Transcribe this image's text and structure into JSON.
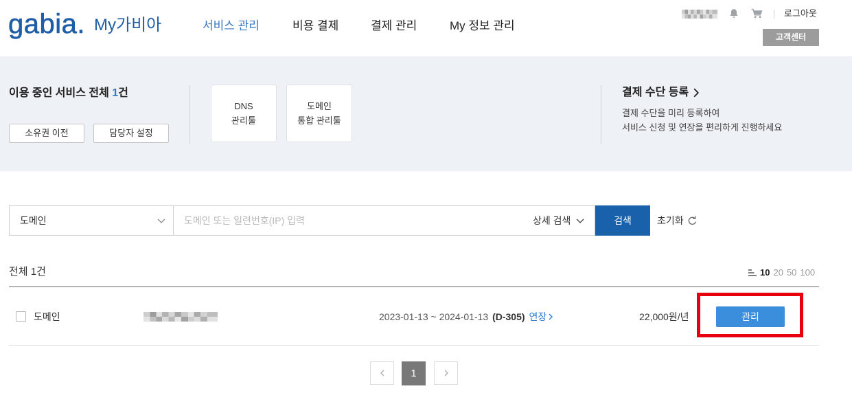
{
  "header": {
    "logo_text": "gabia.",
    "app_name": "My가비아",
    "nav": [
      {
        "label": "서비스 관리",
        "active": true
      },
      {
        "label": "비용 결제",
        "active": false
      },
      {
        "label": "결제 관리",
        "active": false
      },
      {
        "label": "My 정보 관리",
        "active": false
      }
    ],
    "logout_label": "로그아웃",
    "support_label": "고객센터"
  },
  "summary": {
    "title_prefix": "이용 중인 서비스 전체 ",
    "count": "1",
    "title_suffix": "건",
    "actions": [
      {
        "label": "소유권 이전"
      },
      {
        "label": "담당자 설정"
      }
    ],
    "tools": [
      {
        "line1": "DNS",
        "line2": "관리툴"
      },
      {
        "line1": "도메인",
        "line2": "통합 관리툴"
      }
    ],
    "payment": {
      "title": "결제 수단 등록",
      "desc_line1": "결제 수단을 미리 등록하여",
      "desc_line2": "서비스 신청 및 연장을 편리하게 진행하세요"
    }
  },
  "search": {
    "category_selected": "도메인",
    "placeholder": "도메인 또는 일련번호(IP) 입력",
    "advanced_label": "상세 검색",
    "submit_label": "검색",
    "reset_label": "초기화"
  },
  "list": {
    "total_label": "전체 1건",
    "page_sizes": [
      {
        "label": "10",
        "selected": true
      },
      {
        "label": "20",
        "selected": false
      },
      {
        "label": "50",
        "selected": false
      },
      {
        "label": "100",
        "selected": false
      }
    ],
    "rows": [
      {
        "checked": false,
        "service": "도메인",
        "period": "2023-01-13 ~ 2024-01-13",
        "dday": "(D-305)",
        "renew_label": "연장",
        "price": "22,000원/년",
        "manage_label": "관리"
      }
    ]
  },
  "pagination": {
    "current": "1"
  },
  "icons": [
    "bell-icon",
    "cart-icon",
    "chevron-down-icon",
    "chevron-right-icon",
    "refresh-icon",
    "list-size-icon",
    "chevron-left-icon"
  ],
  "colors": {
    "brand": "#1f5ea6",
    "nav_active": "#3677c2",
    "accent_blue": "#2b7bd1",
    "banner_bg": "#eef1f5",
    "search_button": "#1a61ab",
    "manage_button": "#3a8edb",
    "highlight": "#e8000e",
    "support_button": "#9c9c9c",
    "current_page": "#787878"
  }
}
